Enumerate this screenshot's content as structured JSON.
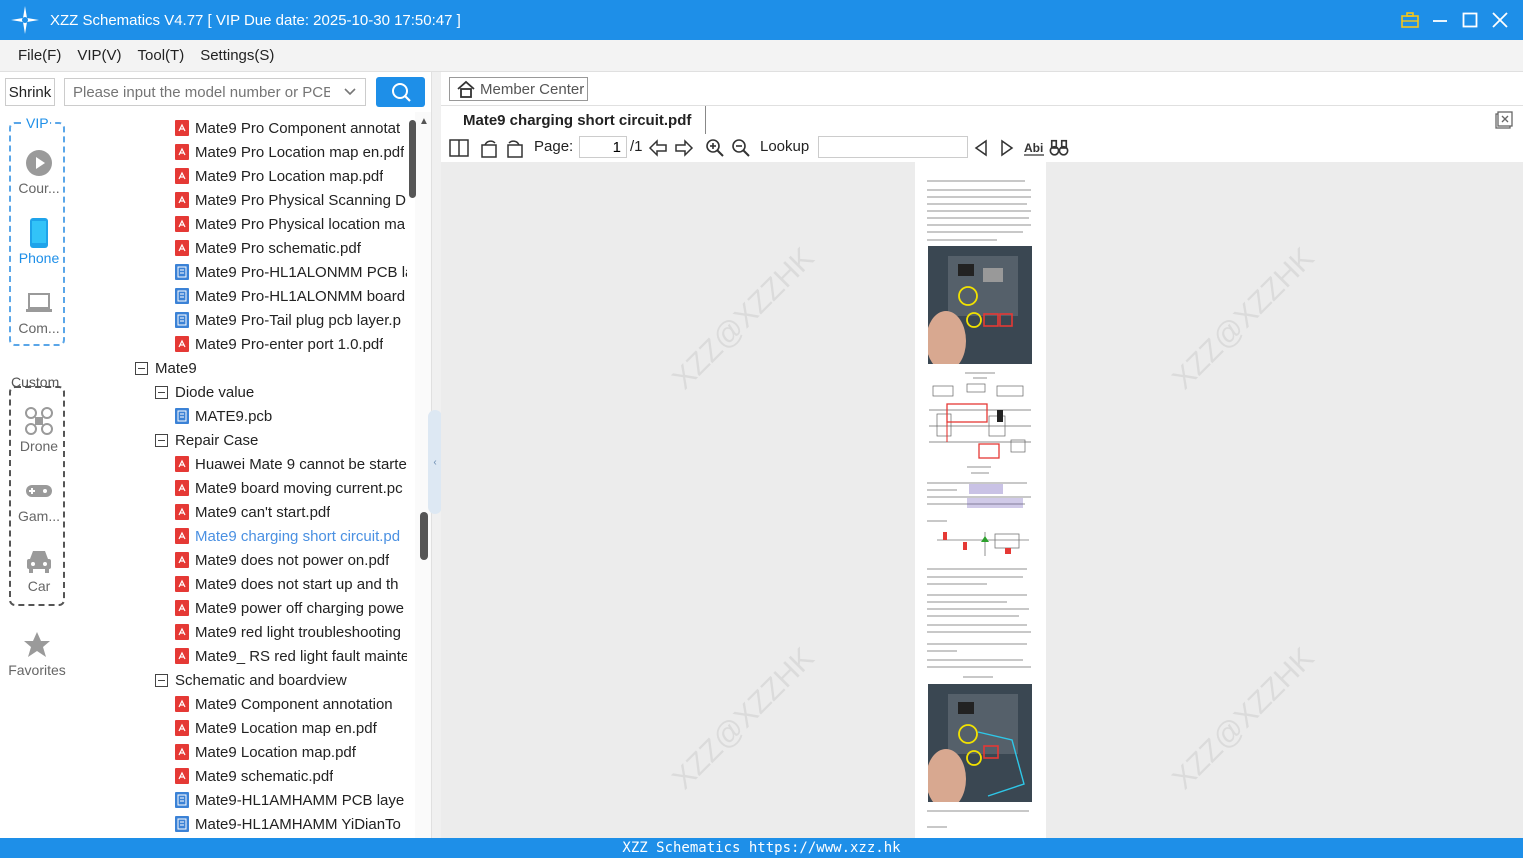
{
  "app": {
    "title": "XZZ Schematics V4.77 [ VIP Due date: 2025-10-30 17:50:47 ]",
    "accent": "#1e8fe8"
  },
  "menu": [
    "File(F)",
    "VIP(V)",
    "Tool(T)",
    "Settings(S)"
  ],
  "search": {
    "shrink_label": "Shrink",
    "placeholder": "Please input the model number or PCB"
  },
  "leftnav": {
    "vip_label": "VIP",
    "custom_label": "Custom",
    "items": [
      {
        "label": "Cour...",
        "icon": "play-icon"
      },
      {
        "label": "Phone",
        "icon": "phone-icon"
      },
      {
        "label": "Com...",
        "icon": "laptop-icon"
      },
      {
        "label": "Drone",
        "icon": "drone-icon"
      },
      {
        "label": "Gam...",
        "icon": "gamepad-icon"
      },
      {
        "label": "Car",
        "icon": "car-icon"
      },
      {
        "label": "Favorites",
        "icon": "star-icon"
      }
    ]
  },
  "tree": [
    {
      "label": "Mate9 Pro Component annotat",
      "type": "pdf",
      "level": 3
    },
    {
      "label": "Mate9 Pro Location map en.pdf",
      "type": "pdf",
      "level": 3
    },
    {
      "label": "Mate9 Pro Location map.pdf",
      "type": "pdf",
      "level": 3
    },
    {
      "label": "Mate9 Pro Physical Scanning D",
      "type": "pdf",
      "level": 3
    },
    {
      "label": "Mate9 Pro Physical location ma",
      "type": "pdf",
      "level": 3
    },
    {
      "label": "Mate9 Pro schematic.pdf",
      "type": "pdf",
      "level": 3
    },
    {
      "label": "Mate9 Pro-HL1ALONMM PCB la",
      "type": "pcb",
      "level": 3
    },
    {
      "label": "Mate9 Pro-HL1ALONMM board",
      "type": "pcb",
      "level": 3
    },
    {
      "label": "Mate9 Pro-Tail plug pcb layer.p",
      "type": "pcb",
      "level": 3
    },
    {
      "label": "Mate9 Pro-enter port 1.0.pdf",
      "type": "pdf",
      "level": 3
    },
    {
      "label": "Mate9",
      "type": "folder",
      "level": 1
    },
    {
      "label": "Diode value",
      "type": "folder",
      "level": 2
    },
    {
      "label": "MATE9.pcb",
      "type": "pcb",
      "level": 3
    },
    {
      "label": "Repair Case",
      "type": "folder",
      "level": 2
    },
    {
      "label": "Huawei Mate 9 cannot be starte",
      "type": "pdf",
      "level": 3
    },
    {
      "label": "Mate9 board moving current.pc",
      "type": "pdf",
      "level": 3
    },
    {
      "label": "Mate9 can't start.pdf",
      "type": "pdf",
      "level": 3
    },
    {
      "label": "Mate9 charging short circuit.pd",
      "type": "pdf",
      "level": 3,
      "selected": true
    },
    {
      "label": "Mate9 does not power on.pdf",
      "type": "pdf",
      "level": 3
    },
    {
      "label": "Mate9 does not start up and th",
      "type": "pdf",
      "level": 3
    },
    {
      "label": "Mate9 power off charging powe",
      "type": "pdf",
      "level": 3
    },
    {
      "label": "Mate9 red light troubleshooting",
      "type": "pdf",
      "level": 3
    },
    {
      "label": "Mate9_ RS red light fault mainte",
      "type": "pdf",
      "level": 3
    },
    {
      "label": "Schematic and boardview",
      "type": "folder",
      "level": 2
    },
    {
      "label": "Mate9 Component annotation",
      "type": "pdf",
      "level": 3
    },
    {
      "label": "Mate9 Location map en.pdf",
      "type": "pdf",
      "level": 3
    },
    {
      "label": "Mate9 Location map.pdf",
      "type": "pdf",
      "level": 3
    },
    {
      "label": "Mate9 schematic.pdf",
      "type": "pdf",
      "level": 3
    },
    {
      "label": "Mate9-HL1AMHAMM PCB laye",
      "type": "pcb",
      "level": 3
    },
    {
      "label": "Mate9-HL1AMHAMM YiDianTo",
      "type": "pcb",
      "level": 3
    }
  ],
  "viewer": {
    "member_center": "Member Center",
    "tab_title": "Mate9 charging short circuit.pdf",
    "page_label": "Page:",
    "page_current": "1",
    "page_total": "/1",
    "lookup_label": "Lookup",
    "watermark": "XZZ@XZZHK"
  },
  "status": {
    "text": "XZZ Schematics https://www.xzz.hk"
  }
}
